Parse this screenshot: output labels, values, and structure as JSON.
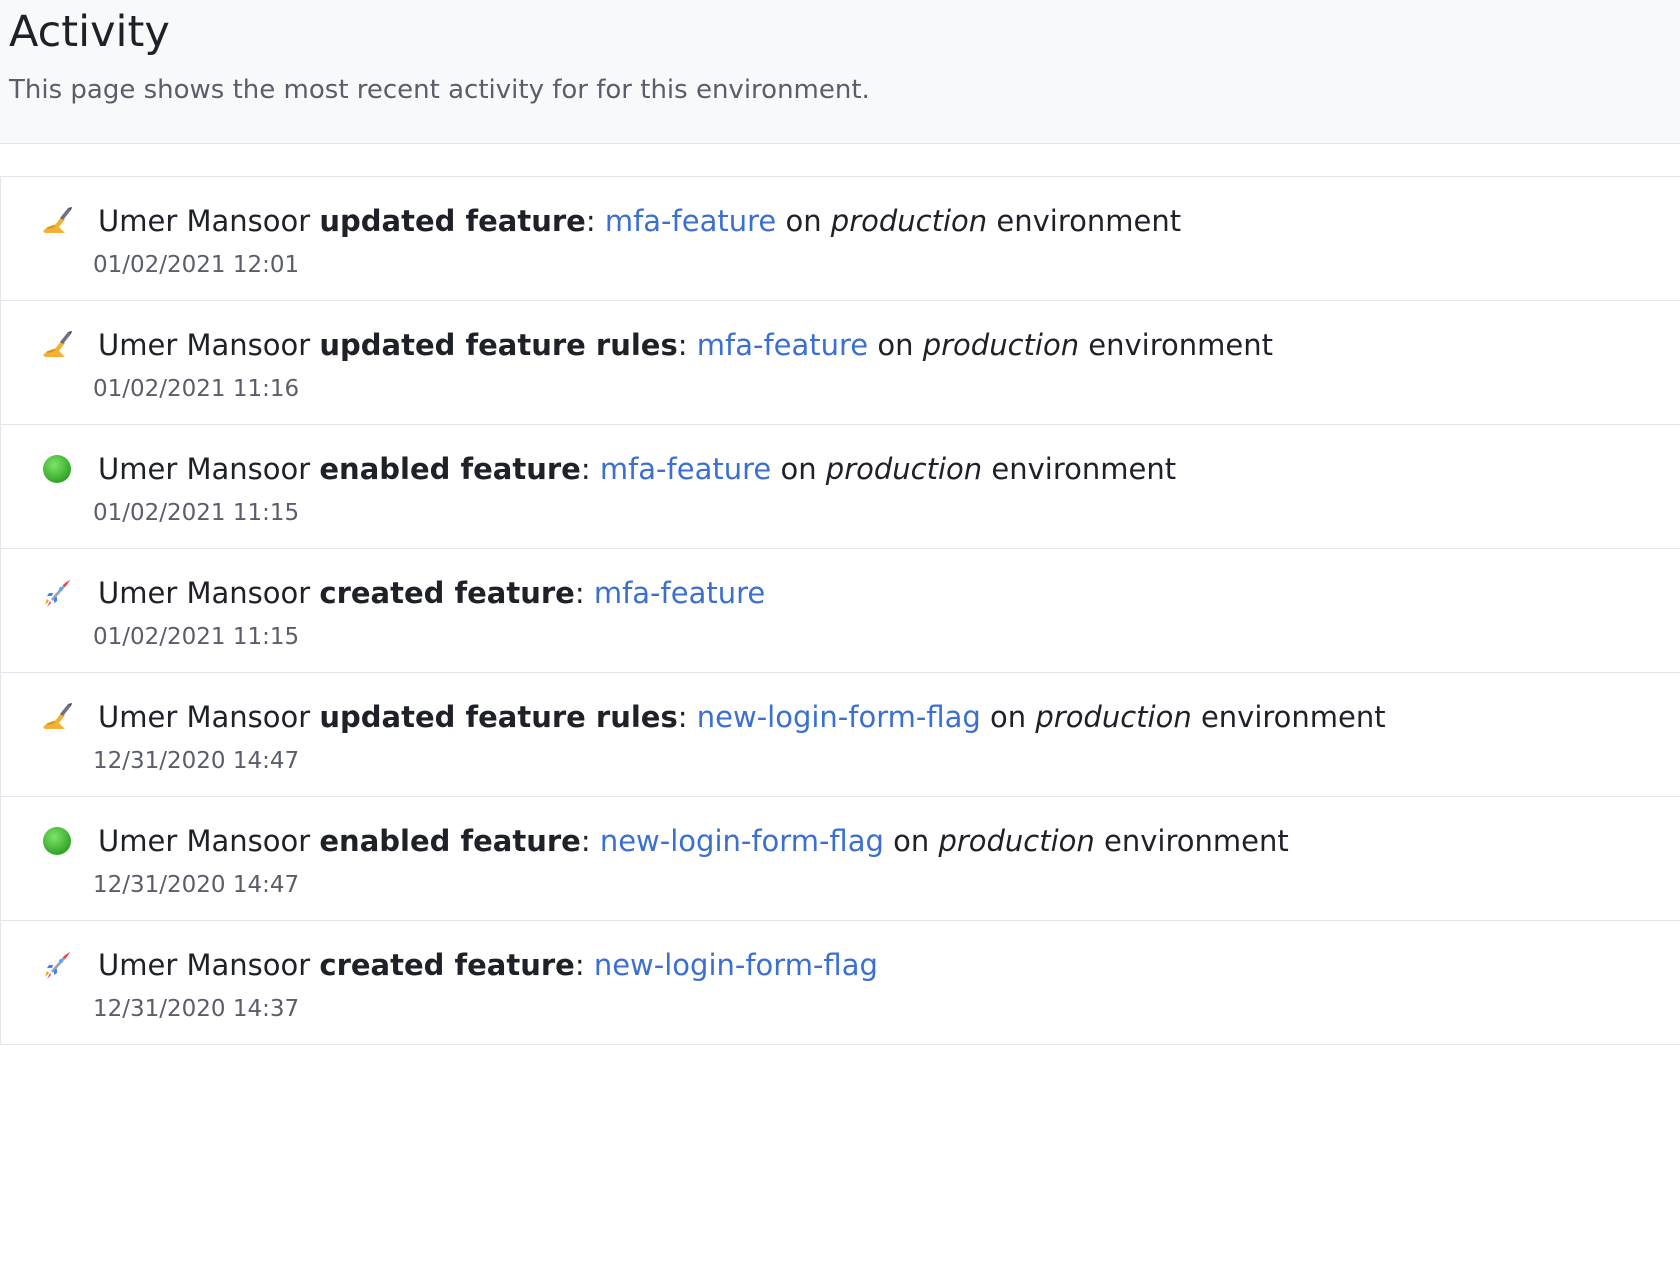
{
  "header": {
    "title": "Activity",
    "subtitle": "This page shows the most recent activity for for this environment."
  },
  "activities": [
    {
      "icon": "writing-hand-icon",
      "user": "Umer Mansoor",
      "action": "updated feature",
      "sep": ":",
      "feature": "mfa-feature",
      "on": "on",
      "environment": "production",
      "env_suffix": "environment",
      "timestamp": "01/02/2021 12:01"
    },
    {
      "icon": "writing-hand-icon",
      "user": "Umer Mansoor",
      "action": "updated feature rules",
      "sep": ":",
      "feature": "mfa-feature",
      "on": "on",
      "environment": "production",
      "env_suffix": "environment",
      "timestamp": "01/02/2021 11:16"
    },
    {
      "icon": "green-circle-icon",
      "user": "Umer Mansoor",
      "action": "enabled feature",
      "sep": ":",
      "feature": "mfa-feature",
      "on": "on",
      "environment": "production",
      "env_suffix": "environment",
      "timestamp": "01/02/2021 11:15"
    },
    {
      "icon": "rocket-icon",
      "user": "Umer Mansoor",
      "action": "created feature",
      "sep": ":",
      "feature": "mfa-feature",
      "on": "",
      "environment": "",
      "env_suffix": "",
      "timestamp": "01/02/2021 11:15"
    },
    {
      "icon": "writing-hand-icon",
      "user": "Umer Mansoor",
      "action": "updated feature rules",
      "sep": ":",
      "feature": "new-login-form-flag",
      "on": "on",
      "environment": "production",
      "env_suffix": "environment",
      "timestamp": "12/31/2020 14:47"
    },
    {
      "icon": "green-circle-icon",
      "user": "Umer Mansoor",
      "action": "enabled feature",
      "sep": ":",
      "feature": "new-login-form-flag",
      "on": "on",
      "environment": "production",
      "env_suffix": "environment",
      "timestamp": "12/31/2020 14:47"
    },
    {
      "icon": "rocket-icon",
      "user": "Umer Mansoor",
      "action": "created feature",
      "sep": ":",
      "feature": "new-login-form-flag",
      "on": "",
      "environment": "",
      "env_suffix": "",
      "timestamp": "12/31/2020 14:37"
    }
  ],
  "colors": {
    "link": "#3b6fd1",
    "text": "#1f2128",
    "muted": "#5b5e6a",
    "header_bg": "#f8f9fb",
    "border": "#e3e5ea"
  }
}
